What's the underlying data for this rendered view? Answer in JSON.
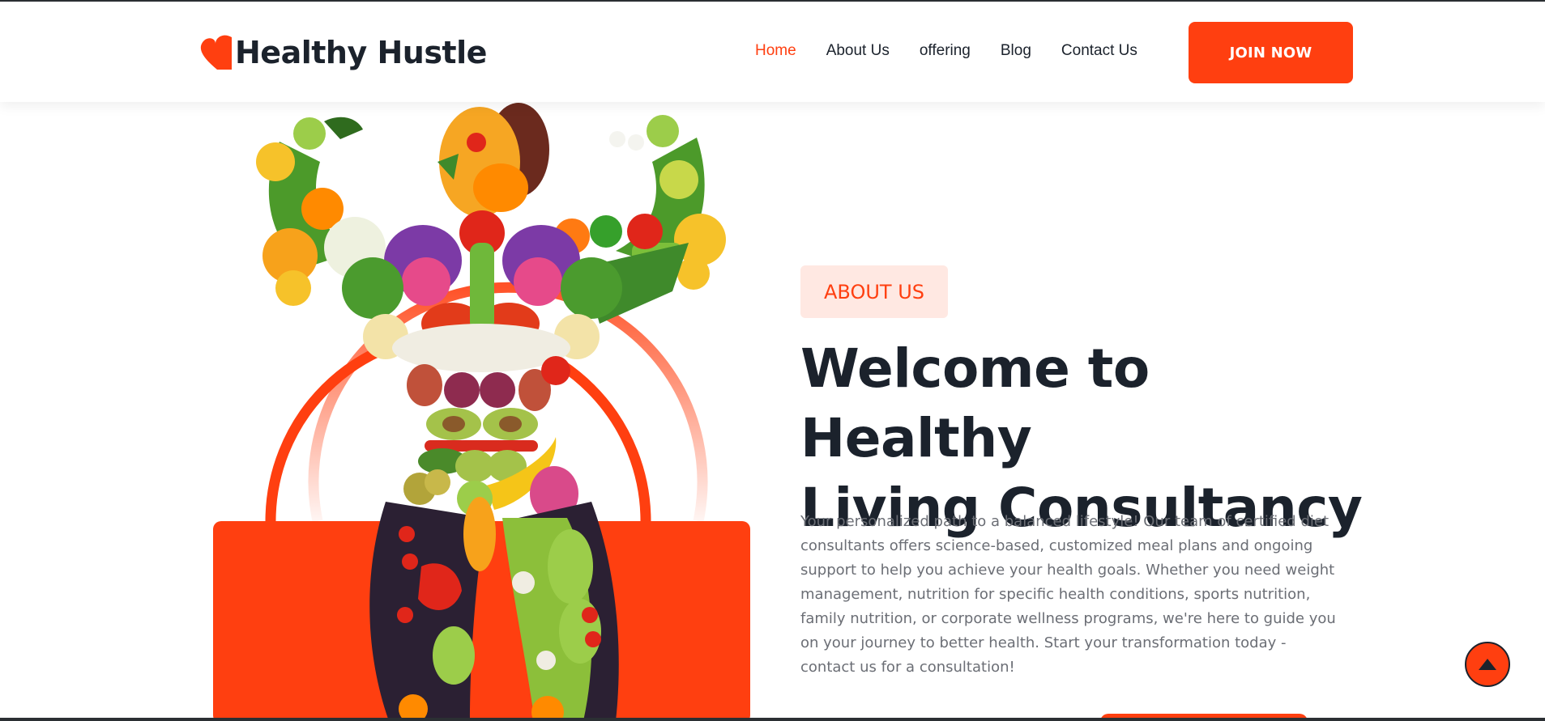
{
  "brand": {
    "name": "Healthy Hustle",
    "accent": "#ff3f10",
    "dark": "#1b222c"
  },
  "nav": {
    "items": [
      {
        "label": "Home",
        "active": true
      },
      {
        "label": "About Us",
        "active": false
      },
      {
        "label": "offering",
        "active": false
      },
      {
        "label": "Blog",
        "active": false
      },
      {
        "label": "Contact Us",
        "active": false
      }
    ],
    "cta_label": "JOIN NOW"
  },
  "hero": {
    "image": "vegetable-bodybuilder-illustration",
    "badge": "ABOUT US",
    "title_line1": "Welcome to Healthy",
    "title_line2": "Living Consultancy",
    "description": "Your personalized path to a balanced lifestyle! Our team of certified diet consultants offers science-based, customized meal plans and ongoing support to help you achieve your health goals. Whether you need weight management, nutrition for specific health conditions, sports nutrition, family nutrition, or corporate wellness programs, we're here to guide you on your journey to better health. Start your transformation today - contact us for a consultation!"
  },
  "icons": {
    "logo": "heart-icon",
    "scroll_top": "arrow-up-icon"
  }
}
